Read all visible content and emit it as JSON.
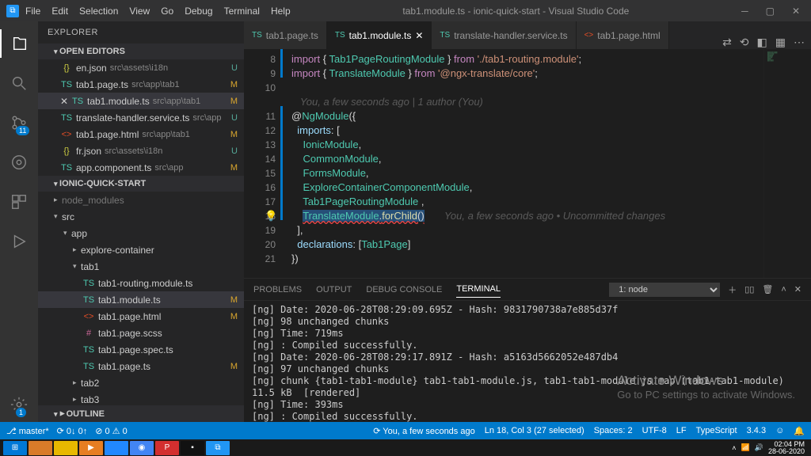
{
  "title": "tab1.module.ts - ionic-quick-start - Visual Studio Code",
  "menu": [
    "File",
    "Edit",
    "Selection",
    "View",
    "Go",
    "Debug",
    "Terminal",
    "Help"
  ],
  "explorer": {
    "header": "EXPLORER",
    "open_editors": "OPEN EDITORS",
    "project": "IONIC-QUICK-START",
    "outline": "OUTLINE"
  },
  "openEditors": [
    {
      "icon": "{}",
      "cls": "fic-json",
      "name": "en.json",
      "path": "src\\assets\\i18n",
      "tag": "U"
    },
    {
      "icon": "TS",
      "cls": "fic-ts",
      "name": "tab1.page.ts",
      "path": "src\\app\\tab1",
      "tag": "M"
    },
    {
      "icon": "TS",
      "cls": "fic-ts",
      "name": "tab1.module.ts",
      "path": "src\\app\\tab1",
      "tag": "M",
      "sel": true,
      "close": true
    },
    {
      "icon": "TS",
      "cls": "fic-ts",
      "name": "translate-handler.service.ts",
      "path": "src\\app",
      "tag": "U"
    },
    {
      "icon": "<>",
      "cls": "fic-html",
      "name": "tab1.page.html",
      "path": "src\\app\\tab1",
      "tag": "M"
    },
    {
      "icon": "{}",
      "cls": "fic-json",
      "name": "fr.json",
      "path": "src\\assets\\i18n",
      "tag": "U"
    },
    {
      "icon": "TS",
      "cls": "fic-ts",
      "name": "app.component.ts",
      "path": "src\\app",
      "tag": "M"
    }
  ],
  "tree": [
    {
      "d": 1,
      "chev": "▸",
      "name": "node_modules",
      "dim": true
    },
    {
      "d": 1,
      "chev": "▾",
      "name": "src"
    },
    {
      "d": 2,
      "chev": "▾",
      "name": "app"
    },
    {
      "d": 3,
      "chev": "▸",
      "name": "explore-container"
    },
    {
      "d": 3,
      "chev": "▾",
      "name": "tab1"
    },
    {
      "d": 4,
      "icon": "TS",
      "cls": "fic-ts",
      "name": "tab1-routing.module.ts"
    },
    {
      "d": 4,
      "icon": "TS",
      "cls": "fic-ts",
      "name": "tab1.module.ts",
      "tag": "M",
      "sel": true
    },
    {
      "d": 4,
      "icon": "<>",
      "cls": "fic-html",
      "name": "tab1.page.html",
      "tag": "M"
    },
    {
      "d": 4,
      "icon": "#",
      "cls": "fic-scss",
      "name": "tab1.page.scss"
    },
    {
      "d": 4,
      "icon": "TS",
      "cls": "fic-ts",
      "name": "tab1.page.spec.ts"
    },
    {
      "d": 4,
      "icon": "TS",
      "cls": "fic-ts",
      "name": "tab1.page.ts",
      "tag": "M"
    },
    {
      "d": 3,
      "chev": "▸",
      "name": "tab2"
    },
    {
      "d": 3,
      "chev": "▸",
      "name": "tab3"
    }
  ],
  "tabs": [
    {
      "icon": "TS",
      "cls": "fic-ts",
      "name": "tab1.page.ts"
    },
    {
      "icon": "TS",
      "cls": "fic-ts",
      "name": "tab1.module.ts",
      "active": true
    },
    {
      "icon": "TS",
      "cls": "fic-ts",
      "name": "translate-handler.service.ts"
    },
    {
      "icon": "<>",
      "cls": "fic-html",
      "name": "tab1.page.html"
    }
  ],
  "code": {
    "start": 8,
    "blame_top": "You, a few seconds ago | 1 author (You)",
    "lines": [
      "import { Tab1PageRoutingModule } from './tab1-routing.module';",
      "import { TranslateModule } from '@ngx-translate/core';",
      "",
      "@NgModule({",
      "  imports: [",
      "    IonicModule,",
      "    CommonModule,",
      "    FormsModule,",
      "    ExploreContainerComponentModule,",
      "    Tab1PageRoutingModule ,",
      "    TranslateModule.forChild()",
      "  ],",
      "  declarations: [Tab1Page]",
      "})"
    ],
    "blame_inline": "You, a few seconds ago • Uncommitted changes"
  },
  "panel": {
    "tabs": [
      "PROBLEMS",
      "OUTPUT",
      "DEBUG CONSOLE",
      "TERMINAL"
    ],
    "active": "TERMINAL",
    "select": "1: node",
    "lines": [
      "[ng] Date: 2020-06-28T08:29:09.695Z - Hash: 9831790738a7e885d37f",
      "[ng] 98 unchanged chunks",
      "[ng] Time: 719ms",
      "[ng] : Compiled successfully.",
      "[ng] Date: 2020-06-28T08:29:17.891Z - Hash: a5163d5662052e487db4",
      "[ng] 97 unchanged chunks",
      "[ng] chunk {tab1-tab1-module} tab1-tab1-module.js, tab1-tab1-module.js.map (tab1-tab1-module) 11.5 kB  [rendered]",
      "[ng] Time: 393ms",
      "[ng] : Compiled successfully.",
      "▯"
    ]
  },
  "status": {
    "branch": "master*",
    "sync": "⟳ 0↓ 0↑",
    "err": "⊘ 0 ⚠ 0",
    "blame": "⟳ You, a few seconds ago",
    "ln": "Ln 18, Col 3 (27 selected)",
    "spaces": "Spaces: 2",
    "enc": "UTF-8",
    "eol": "LF",
    "lang": "TypeScript",
    "ver": "3.4.3"
  },
  "watermark": {
    "title": "Activate Windows",
    "sub": "Go to PC settings to activate Windows."
  },
  "tray": {
    "time": "02:04 PM",
    "date": "28-06-2020"
  },
  "activity_badge": "11",
  "gear_badge": "1"
}
